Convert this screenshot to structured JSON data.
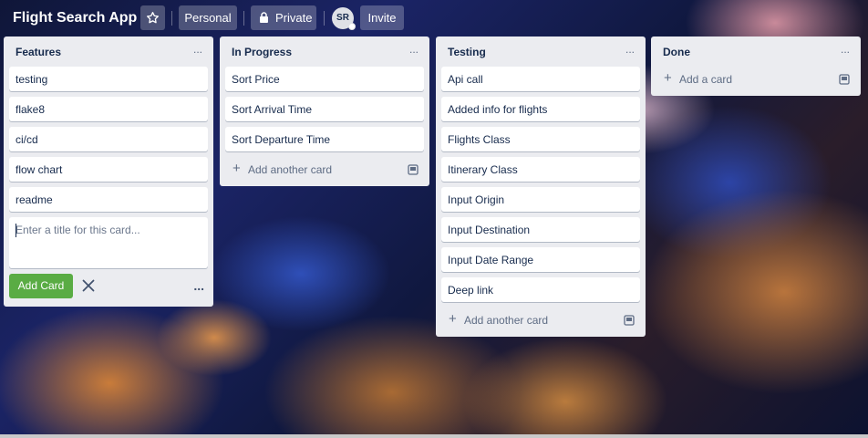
{
  "header": {
    "board_title": "Flight Search App",
    "personal_label": "Personal",
    "private_label": "Private",
    "avatar_initials": "SR",
    "invite_label": "Invite"
  },
  "lists": [
    {
      "title": "Features",
      "menu": "...",
      "cards": [
        "testing",
        "flake8",
        "ci/cd",
        "flow chart",
        "readme"
      ],
      "composer": {
        "placeholder": "Enter a title for this card...",
        "value": "",
        "add_label": "Add Card",
        "more": "..."
      }
    },
    {
      "title": "In Progress",
      "menu": "...",
      "cards": [
        "Sort Price",
        "Sort Arrival Time",
        "Sort Departure Time"
      ],
      "add_label": "Add another card"
    },
    {
      "title": "Testing",
      "menu": "...",
      "cards": [
        "Api call",
        "Added info for flights",
        "Flights Class",
        "Itinerary Class",
        "Input Origin",
        "Input Destination",
        "Input Date Range",
        "Deep link"
      ],
      "add_label": "Add another card"
    },
    {
      "title": "Done",
      "menu": "...",
      "cards": [],
      "add_label": "Add a card"
    }
  ],
  "icons": {
    "star": "star-icon",
    "lock": "lock-icon",
    "close": "close-icon",
    "plus": "plus-icon",
    "template": "card-template-icon"
  },
  "colors": {
    "list_bg": "#ebecf0",
    "card_text": "#172b4d",
    "add_card_button": "#5aac44",
    "muted_text": "#5e6c84"
  }
}
